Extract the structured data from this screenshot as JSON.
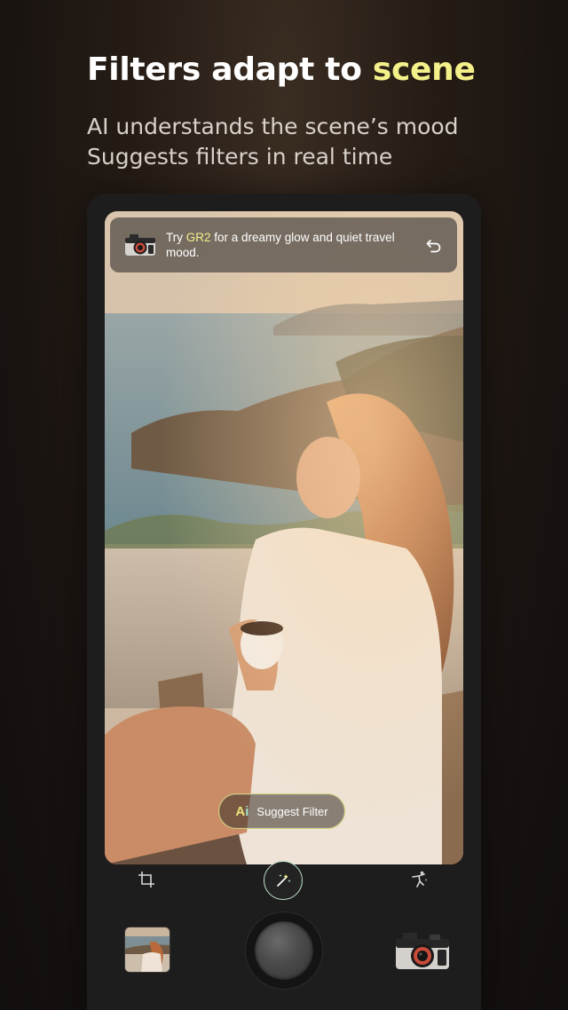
{
  "headline": {
    "part1": "Filters adapt to ",
    "part2": "scene"
  },
  "subtitle": {
    "line1": "AI understands the scene’s mood",
    "line2": "Suggests filters in real time"
  },
  "suggestion": {
    "prefix": "Try ",
    "filter_name": "GR2",
    "suffix": " for a dreamy glow and quiet travel mood.",
    "icon": "camera-icon",
    "action_icon": "undo-icon"
  },
  "suggest_button": {
    "ai_letter1": "A",
    "ai_letter2": "i",
    "label": "Suggest Filter"
  },
  "toolbar": {
    "left_icon": "crop-icon",
    "center_icon": "magic-wand-icon",
    "right_icon": "pose-icon"
  },
  "colors": {
    "accent_yellow": "#f4f08a",
    "accent_mint": "#b9e3c8",
    "panel": "#1e1d1d"
  }
}
